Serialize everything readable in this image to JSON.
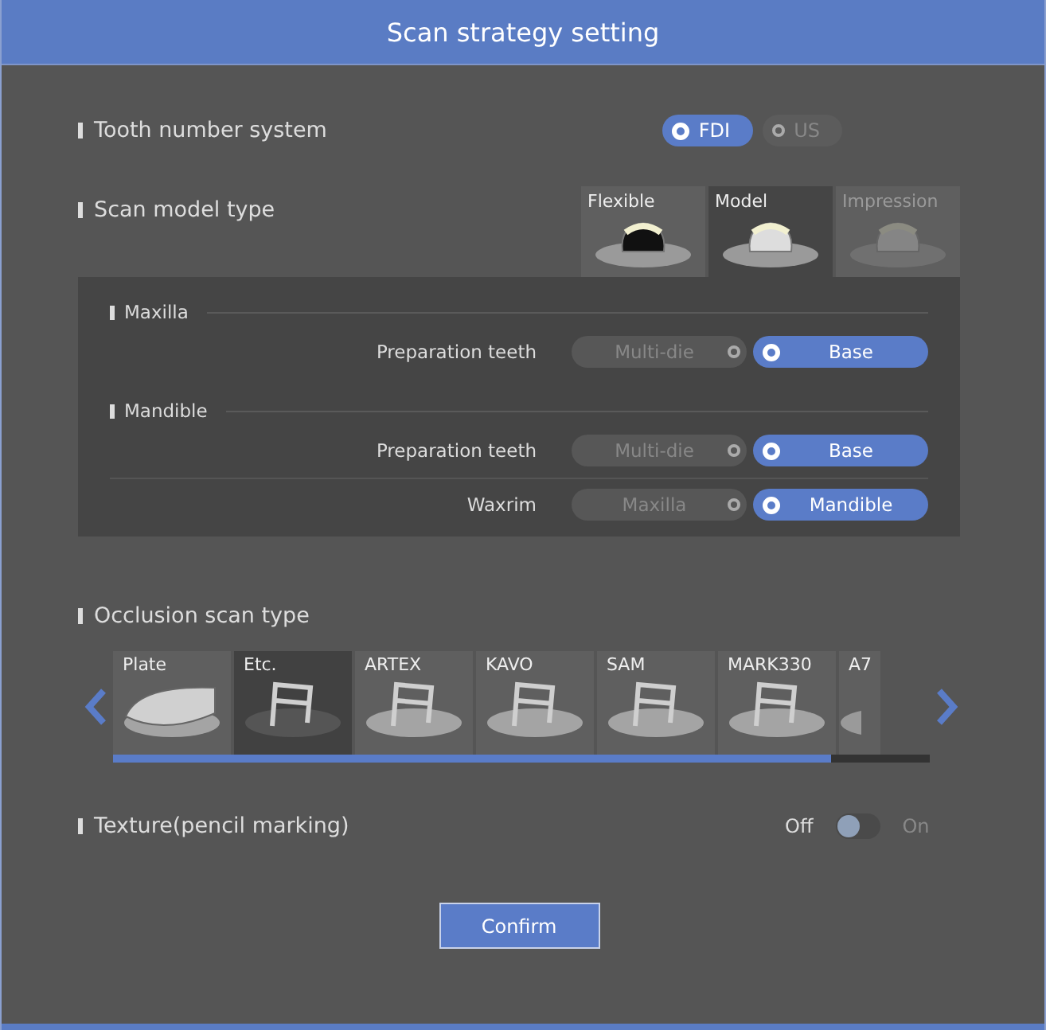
{
  "window": {
    "title": "Scan strategy setting"
  },
  "tooth_number_system": {
    "label": "Tooth number system",
    "options": [
      {
        "label": "FDI",
        "selected": true
      },
      {
        "label": "US",
        "selected": false
      }
    ]
  },
  "scan_model_type": {
    "label": "Scan model type",
    "tabs": [
      {
        "label": "Flexible",
        "selected": false,
        "disabled": false
      },
      {
        "label": "Model",
        "selected": true,
        "disabled": false
      },
      {
        "label": "Impression",
        "selected": false,
        "disabled": true
      }
    ]
  },
  "groups": [
    {
      "title": "Maxilla",
      "rows": [
        {
          "label": "Preparation teeth",
          "options": [
            {
              "label": "Multi-die",
              "selected": false
            },
            {
              "label": "Base",
              "selected": true
            }
          ]
        }
      ]
    },
    {
      "title": "Mandible",
      "rows": [
        {
          "label": "Preparation teeth",
          "options": [
            {
              "label": "Multi-die",
              "selected": false
            },
            {
              "label": "Base",
              "selected": true
            }
          ]
        },
        {
          "label": "Waxrim",
          "options": [
            {
              "label": "Maxilla",
              "selected": false
            },
            {
              "label": "Mandible",
              "selected": true
            }
          ]
        }
      ]
    }
  ],
  "occlusion_scan_type": {
    "label": "Occlusion scan type",
    "items": [
      {
        "label": "Plate",
        "selected": false
      },
      {
        "label": "Etc.",
        "selected": true
      },
      {
        "label": "ARTEX",
        "selected": false
      },
      {
        "label": "KAVO",
        "selected": false
      },
      {
        "label": "SAM",
        "selected": false
      },
      {
        "label": "MARK330",
        "selected": false
      },
      {
        "label": "A7",
        "selected": false
      }
    ]
  },
  "texture": {
    "label": "Texture(pencil marking)",
    "off_label": "Off",
    "on_label": "On",
    "on": false
  },
  "buttons": [
    "Confirm"
  ]
}
